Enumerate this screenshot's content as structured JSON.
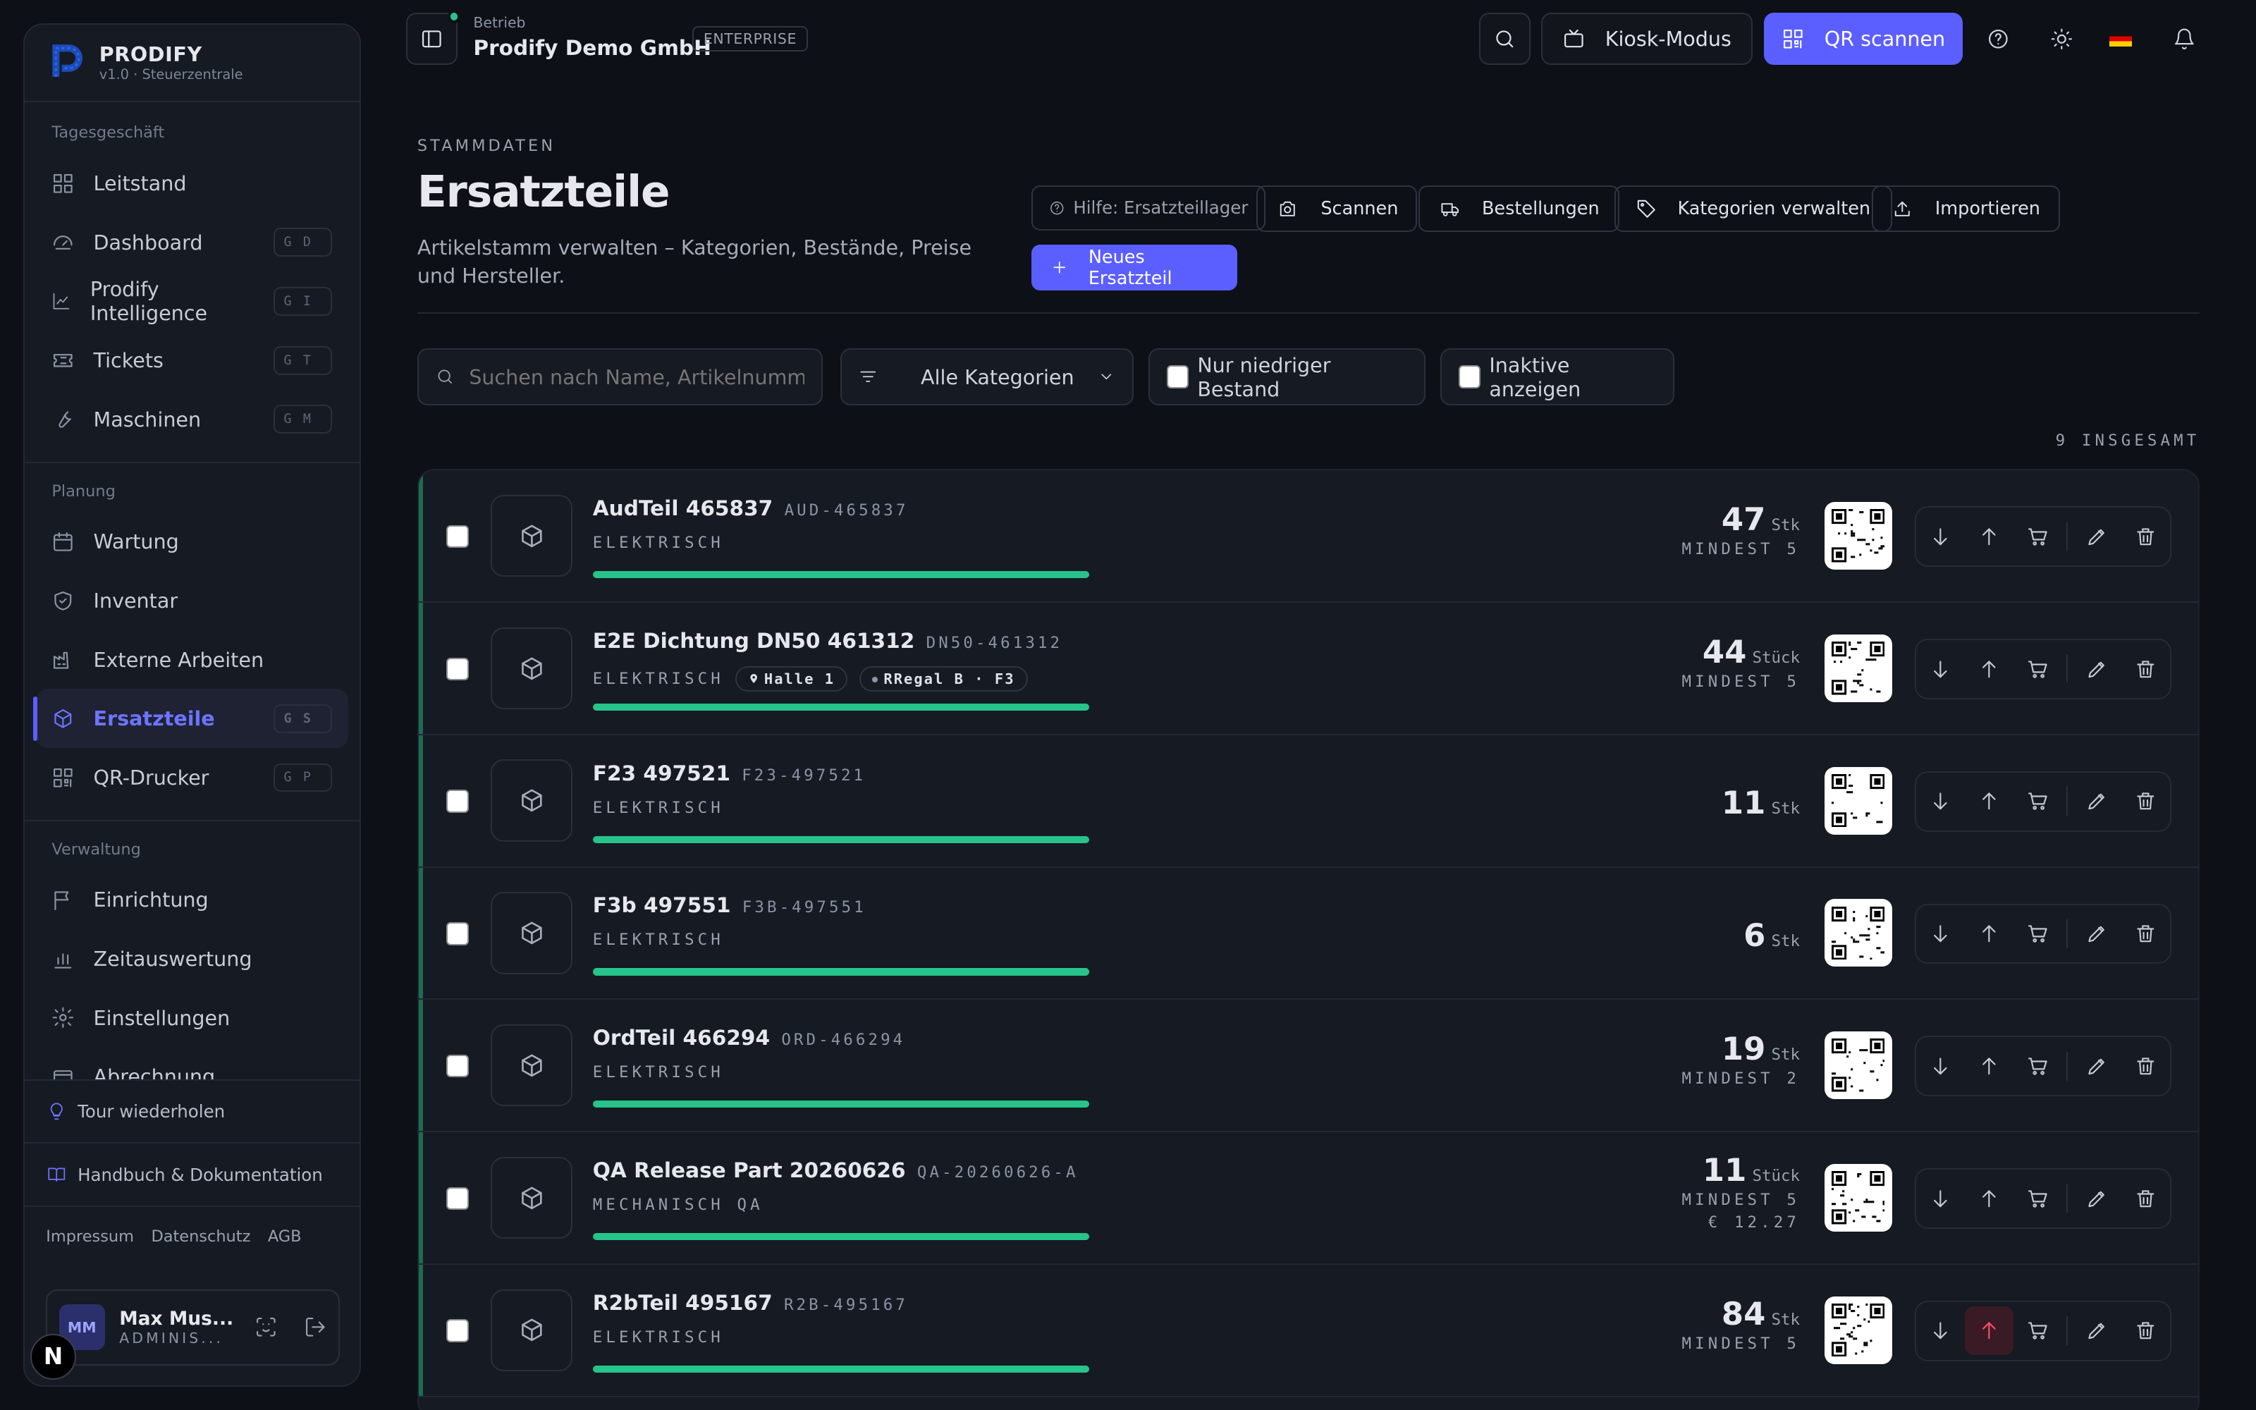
{
  "sidebar": {
    "brand": {
      "name": "PRODIFY",
      "sub": "v1.0 · Steuerzentrale"
    },
    "sections": [
      {
        "label": "Tagesgeschäft",
        "items": [
          {
            "label": "Leitstand",
            "icon": "grid-icon",
            "kbd": ""
          },
          {
            "label": "Dashboard",
            "icon": "gauge-icon",
            "kbd": "GD"
          },
          {
            "label": "Prodify Intelligence",
            "icon": "chart-line-icon",
            "kbd": "GI"
          },
          {
            "label": "Tickets",
            "icon": "ticket-icon",
            "kbd": "GT"
          },
          {
            "label": "Maschinen",
            "icon": "wrench-icon",
            "kbd": "GM"
          }
        ]
      },
      {
        "label": "Planung",
        "items": [
          {
            "label": "Wartung",
            "icon": "calendar-icon",
            "kbd": ""
          },
          {
            "label": "Inventar",
            "icon": "shield-check-icon",
            "kbd": ""
          },
          {
            "label": "Externe Arbeiten",
            "icon": "factory-icon",
            "kbd": ""
          },
          {
            "label": "Ersatzteile",
            "icon": "package-icon",
            "kbd": "GS"
          },
          {
            "label": "QR-Drucker",
            "icon": "qr-icon",
            "kbd": "GP"
          }
        ]
      },
      {
        "label": "Verwaltung",
        "items": [
          {
            "label": "Einrichtung",
            "icon": "flag-icon",
            "kbd": ""
          },
          {
            "label": "Zeitauswertung",
            "icon": "bar-chart-icon",
            "kbd": ""
          },
          {
            "label": "Einstellungen",
            "icon": "gear-icon",
            "kbd": ""
          },
          {
            "label": "Abrechnung",
            "icon": "card-icon",
            "kbd": ""
          }
        ]
      }
    ],
    "tour": "Tour wiederholen",
    "handbook": "Handbuch & Dokumentation",
    "legal": [
      "Impressum",
      "Datenschutz",
      "AGB"
    ],
    "user": {
      "initials": "MM",
      "name": "Max Mus...",
      "role": "ADMINIS..."
    },
    "next_badge": "N"
  },
  "topbar": {
    "org_label": "Betrieb",
    "org_name": "Prodify Demo GmbH",
    "plan": "ENTERPRISE",
    "kiosk": "Kiosk-Modus",
    "qr_scan": "QR scannen"
  },
  "page": {
    "eyebrow": "STAMMDATEN",
    "title": "Ersatzteile",
    "description": "Artikelstamm verwalten – Kategorien, Bestände, Preise und Hersteller.",
    "actions": {
      "help": "Hilfe: Ersatzteillager",
      "scan": "Scannen",
      "orders": "Bestellungen",
      "categories": "Kategorien verwalten",
      "import": "Importieren",
      "new": "Neues Ersatzteil"
    },
    "filters": {
      "search_placeholder": "Suchen nach Name, Artikelnummer",
      "category": "Alle Kategorien",
      "low_stock": "Nur niedriger Bestand",
      "inactive": "Inaktive anzeigen"
    },
    "total": "9 INSGESAMT"
  },
  "colors": {
    "accent": "#5b5fff",
    "stock_bar": "#26c48a",
    "danger": "#ff4d6d"
  },
  "parts": [
    {
      "name": "AudTeil 465837",
      "sku": "AUD-465837",
      "category": "ELEKTRISCH",
      "location": "",
      "shelf": "",
      "qty": "47",
      "unit": "Stk",
      "min": "MINDEST 5",
      "price": "",
      "stock_fill": 1.0
    },
    {
      "name": "E2E Dichtung DN50 461312",
      "sku": "DN50-461312",
      "category": "ELEKTRISCH",
      "location": "Halle 1",
      "shelf": "RRegal B · F3",
      "qty": "44",
      "unit": "Stück",
      "min": "MINDEST 5",
      "price": "",
      "stock_fill": 1.0
    },
    {
      "name": "F23 497521",
      "sku": "F23-497521",
      "category": "ELEKTRISCH",
      "location": "",
      "shelf": "",
      "qty": "11",
      "unit": "Stk",
      "min": "",
      "price": "",
      "stock_fill": 1.0
    },
    {
      "name": "F3b 497551",
      "sku": "F3B-497551",
      "category": "ELEKTRISCH",
      "location": "",
      "shelf": "",
      "qty": "6",
      "unit": "Stk",
      "min": "",
      "price": "",
      "stock_fill": 1.0
    },
    {
      "name": "OrdTeil 466294",
      "sku": "ORD-466294",
      "category": "ELEKTRISCH",
      "location": "",
      "shelf": "",
      "qty": "19",
      "unit": "Stk",
      "min": "MINDEST 2",
      "price": "",
      "stock_fill": 1.0
    },
    {
      "name": "QA Release Part 20260626",
      "sku": "QA-20260626-A",
      "category": "MECHANISCH QA",
      "location": "",
      "shelf": "",
      "qty": "11",
      "unit": "Stück",
      "min": "MINDEST 5",
      "price": "€ 12.27",
      "stock_fill": 1.0
    },
    {
      "name": "R2bTeil 495167",
      "sku": "R2B-495167",
      "category": "ELEKTRISCH",
      "location": "",
      "shelf": "",
      "qty": "84",
      "unit": "Stk",
      "min": "MINDEST 5",
      "price": "",
      "stock_fill": 1.0
    }
  ]
}
